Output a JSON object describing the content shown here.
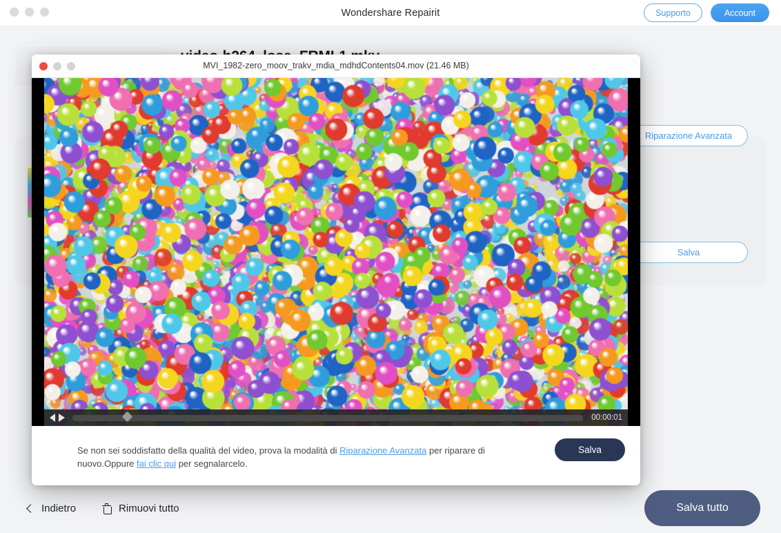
{
  "window": {
    "title": "Wondershare Repairit",
    "traffic_lights": [
      "close",
      "minimize",
      "maximize"
    ],
    "support_label": "Supporto",
    "account_label": "Account",
    "accent_blue": "#4a9be8"
  },
  "background": {
    "file_title": "video-h264_lose_FRML1.mkv",
    "advanced_repair_label": "Riparazione Avanzata",
    "save_label": "Salva"
  },
  "bottom_bar": {
    "back_label": "Indietro",
    "remove_all_label": "Rimuovi tutto",
    "save_all_label": "Salva tutto",
    "save_all_color": "#4f5d81"
  },
  "modal": {
    "title": "MVI_1982-zero_moov_trakv_mdia_mdhdContents04.mov (21.46 MB)",
    "file_name": "MVI_1982-zero_moov_trakv_mdia_mdhdContents04.mov",
    "file_size": "21.46 MB",
    "traffic_lights": [
      "close",
      "minimize",
      "maximize"
    ],
    "player": {
      "current_time": "00:00:01",
      "progress_percent": 10,
      "prev_icon": "previous-icon",
      "play_icon": "play-icon"
    },
    "footer": {
      "text_part1": "Se non sei soddisfatto della qualità del video, prova la modalità di ",
      "link_advanced": "Riparazione Avanzata",
      "text_part2": " per riparare di nuovo.Oppure ",
      "link_report": "fai clic qui",
      "text_part3": " per segnalarcelo.",
      "save_label": "Salva",
      "save_color": "#2a3655"
    }
  }
}
